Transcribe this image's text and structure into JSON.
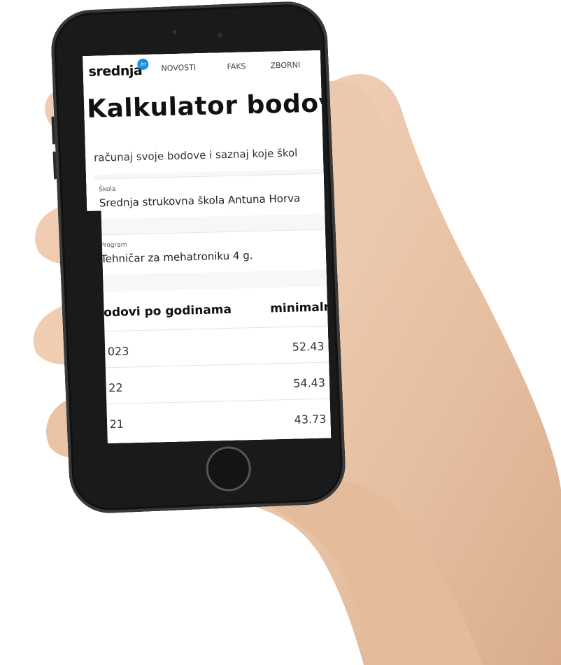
{
  "brand": {
    "logo_text": "srednja",
    "logo_badge": ".hr"
  },
  "nav": {
    "items": [
      "NOVOSTI",
      "FAKS",
      "ZBORNI"
    ]
  },
  "page": {
    "title": "Kalkulator bodova",
    "subtitle": "računaj svoje bodove i saznaj koje škol"
  },
  "form": {
    "school": {
      "label": "Škola",
      "value": "Srednja strukovna škola Antuna Horva"
    },
    "program": {
      "label": "Program",
      "value": "Tehničar za mehatroniku 4 g."
    }
  },
  "table": {
    "headers": [
      "odovi po godinama",
      "minimaln"
    ],
    "rows": [
      {
        "year": "023",
        "points": "52.43"
      },
      {
        "year": "22",
        "points": "54.43"
      },
      {
        "year": "21",
        "points": "43.73"
      }
    ]
  },
  "colors": {
    "badge": "#1a8ddc",
    "skin": "#e9c4a6",
    "phone": "#1a1a1a"
  }
}
